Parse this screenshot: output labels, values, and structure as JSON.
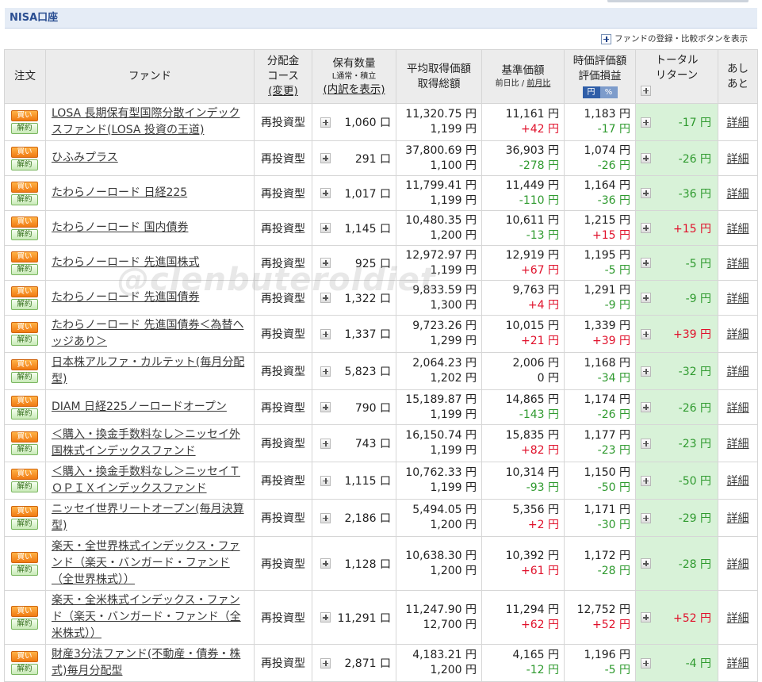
{
  "section_title": "NISA口座",
  "registration_link": "ファンドの登録・比較ボタンを表示",
  "headers": {
    "order": "注文",
    "fund": "ファンド",
    "course_l1": "分配金",
    "course_l2": "コース",
    "course_l3": "(変更)",
    "qty_l1": "保有数量",
    "qty_sub": "L通常・積立",
    "qty_l3": "(内訳を表示)",
    "avg_l1": "平均取得価額",
    "avg_l2": "取得総額",
    "nav_l1": "基準価額",
    "nav_sub_a": "前日比",
    "nav_sub_sep": " / ",
    "nav_sub_b": "前月比",
    "val_l1": "時価評価額",
    "val_l2": "評価損益",
    "toggle_yen": "円",
    "toggle_pct": "%",
    "total_l1": "トータル",
    "total_l2": "リターン",
    "hist_l1": "あし",
    "hist_l2": "あと"
  },
  "labels": {
    "buy": "買い",
    "sell": "解約",
    "detail": "詳細",
    "unit": "口"
  },
  "funds": [
    {
      "name": "LOSA 長期保有型国際分散インデックスファンド(LOSA 投資の王道)",
      "course": "再投資型",
      "qty": "1,060",
      "avg_price": "11,320.75 円",
      "total_cost": "1,199 円",
      "nav": "11,161 円",
      "nav_change": "+42 円",
      "nav_change_sign": "pos",
      "value": "1,183 円",
      "gain": "-17 円",
      "gain_sign": "neg",
      "total_return": "-17 円",
      "total_return_sign": "neg"
    },
    {
      "name": "ひふみプラス",
      "course": "再投資型",
      "qty": "291",
      "avg_price": "37,800.69 円",
      "total_cost": "1,100 円",
      "nav": "36,903 円",
      "nav_change": "-278 円",
      "nav_change_sign": "neg",
      "value": "1,074 円",
      "gain": "-26 円",
      "gain_sign": "neg",
      "total_return": "-26 円",
      "total_return_sign": "neg"
    },
    {
      "name": "たわらノーロード 日経225",
      "course": "再投資型",
      "qty": "1,017",
      "avg_price": "11,799.41 円",
      "total_cost": "1,199 円",
      "nav": "11,449 円",
      "nav_change": "-110 円",
      "nav_change_sign": "neg",
      "value": "1,164 円",
      "gain": "-36 円",
      "gain_sign": "neg",
      "total_return": "-36 円",
      "total_return_sign": "neg"
    },
    {
      "name": "たわらノーロード 国内債券",
      "course": "再投資型",
      "qty": "1,145",
      "avg_price": "10,480.35 円",
      "total_cost": "1,200 円",
      "nav": "10,611 円",
      "nav_change": "-13 円",
      "nav_change_sign": "neg",
      "value": "1,215 円",
      "gain": "+15 円",
      "gain_sign": "pos",
      "total_return": "+15 円",
      "total_return_sign": "pos"
    },
    {
      "name": "たわらノーロード 先進国株式",
      "course": "再投資型",
      "qty": "925",
      "avg_price": "12,972.97 円",
      "total_cost": "1,199 円",
      "nav": "12,919 円",
      "nav_change": "+67 円",
      "nav_change_sign": "pos",
      "value": "1,195 円",
      "gain": "-5 円",
      "gain_sign": "neg",
      "total_return": "-5 円",
      "total_return_sign": "neg"
    },
    {
      "name": "たわらノーロード 先進国債券",
      "course": "再投資型",
      "qty": "1,322",
      "avg_price": "9,833.59 円",
      "total_cost": "1,300 円",
      "nav": "9,763 円",
      "nav_change": "+4 円",
      "nav_change_sign": "pos",
      "value": "1,291 円",
      "gain": "-9 円",
      "gain_sign": "neg",
      "total_return": "-9 円",
      "total_return_sign": "neg"
    },
    {
      "name": "たわらノーロード 先進国債券＜為替ヘッジあり＞",
      "course": "再投資型",
      "qty": "1,337",
      "avg_price": "9,723.26 円",
      "total_cost": "1,299 円",
      "nav": "10,015 円",
      "nav_change": "+21 円",
      "nav_change_sign": "pos",
      "value": "1,339 円",
      "gain": "+39 円",
      "gain_sign": "pos",
      "total_return": "+39 円",
      "total_return_sign": "pos"
    },
    {
      "name": "日本株アルファ・カルテット(毎月分配型)",
      "course": "再投資型",
      "qty": "5,823",
      "avg_price": "2,064.23 円",
      "total_cost": "1,202 円",
      "nav": "2,006 円",
      "nav_change": "0 円",
      "nav_change_sign": "zero",
      "value": "1,168 円",
      "gain": "-34 円",
      "gain_sign": "neg",
      "total_return": "-32 円",
      "total_return_sign": "neg"
    },
    {
      "name": "DIAM 日経225ノーロードオープン",
      "course": "再投資型",
      "qty": "790",
      "avg_price": "15,189.87 円",
      "total_cost": "1,199 円",
      "nav": "14,865 円",
      "nav_change": "-143 円",
      "nav_change_sign": "neg",
      "value": "1,174 円",
      "gain": "-26 円",
      "gain_sign": "neg",
      "total_return": "-26 円",
      "total_return_sign": "neg"
    },
    {
      "name": "＜購入・換金手数料なし＞ニッセイ外国株式インデックスファンド",
      "course": "再投資型",
      "qty": "743",
      "avg_price": "16,150.74 円",
      "total_cost": "1,199 円",
      "nav": "15,835 円",
      "nav_change": "+82 円",
      "nav_change_sign": "pos",
      "value": "1,177 円",
      "gain": "-23 円",
      "gain_sign": "neg",
      "total_return": "-23 円",
      "total_return_sign": "neg"
    },
    {
      "name": "＜購入・換金手数料なし＞ニッセイＴＯＰＩＸインデックスファンド",
      "course": "再投資型",
      "qty": "1,115",
      "avg_price": "10,762.33 円",
      "total_cost": "1,199 円",
      "nav": "10,314 円",
      "nav_change": "-93 円",
      "nav_change_sign": "neg",
      "value": "1,150 円",
      "gain": "-50 円",
      "gain_sign": "neg",
      "total_return": "-50 円",
      "total_return_sign": "neg"
    },
    {
      "name": "ニッセイ世界リートオープン(毎月決算型)",
      "course": "再投資型",
      "qty": "2,186",
      "avg_price": "5,494.05 円",
      "total_cost": "1,200 円",
      "nav": "5,356 円",
      "nav_change": "+2 円",
      "nav_change_sign": "pos",
      "value": "1,171 円",
      "gain": "-30 円",
      "gain_sign": "neg",
      "total_return": "-29 円",
      "total_return_sign": "neg"
    },
    {
      "name": "楽天・全世界株式インデックス・ファンド（楽天・バンガード・ファンド（全世界株式））",
      "course": "再投資型",
      "qty": "1,128",
      "avg_price": "10,638.30 円",
      "total_cost": "1,200 円",
      "nav": "10,392 円",
      "nav_change": "+61 円",
      "nav_change_sign": "pos",
      "value": "1,172 円",
      "gain": "-28 円",
      "gain_sign": "neg",
      "total_return": "-28 円",
      "total_return_sign": "neg",
      "tall": true
    },
    {
      "name": "楽天・全米株式インデックス・ファンド（楽天・バンガード・ファンド（全米株式））",
      "course": "再投資型",
      "qty": "11,291",
      "avg_price": "11,247.90 円",
      "total_cost": "12,700 円",
      "nav": "11,294 円",
      "nav_change": "+62 円",
      "nav_change_sign": "pos",
      "value": "12,752 円",
      "gain": "+52 円",
      "gain_sign": "pos",
      "total_return": "+52 円",
      "total_return_sign": "pos",
      "tall": true
    },
    {
      "name": "財産3分法ファンド(不動産・債券・株式)毎月分配型",
      "course": "再投資型",
      "qty": "2,871",
      "avg_price": "4,183.21 円",
      "total_cost": "1,200 円",
      "nav": "4,165 円",
      "nav_change": "-12 円",
      "nav_change_sign": "neg",
      "value": "1,196 円",
      "gain": "-5 円",
      "gain_sign": "neg",
      "total_return": "-4 円",
      "total_return_sign": "neg"
    }
  ],
  "watermark": "@clenbuteroldiet"
}
